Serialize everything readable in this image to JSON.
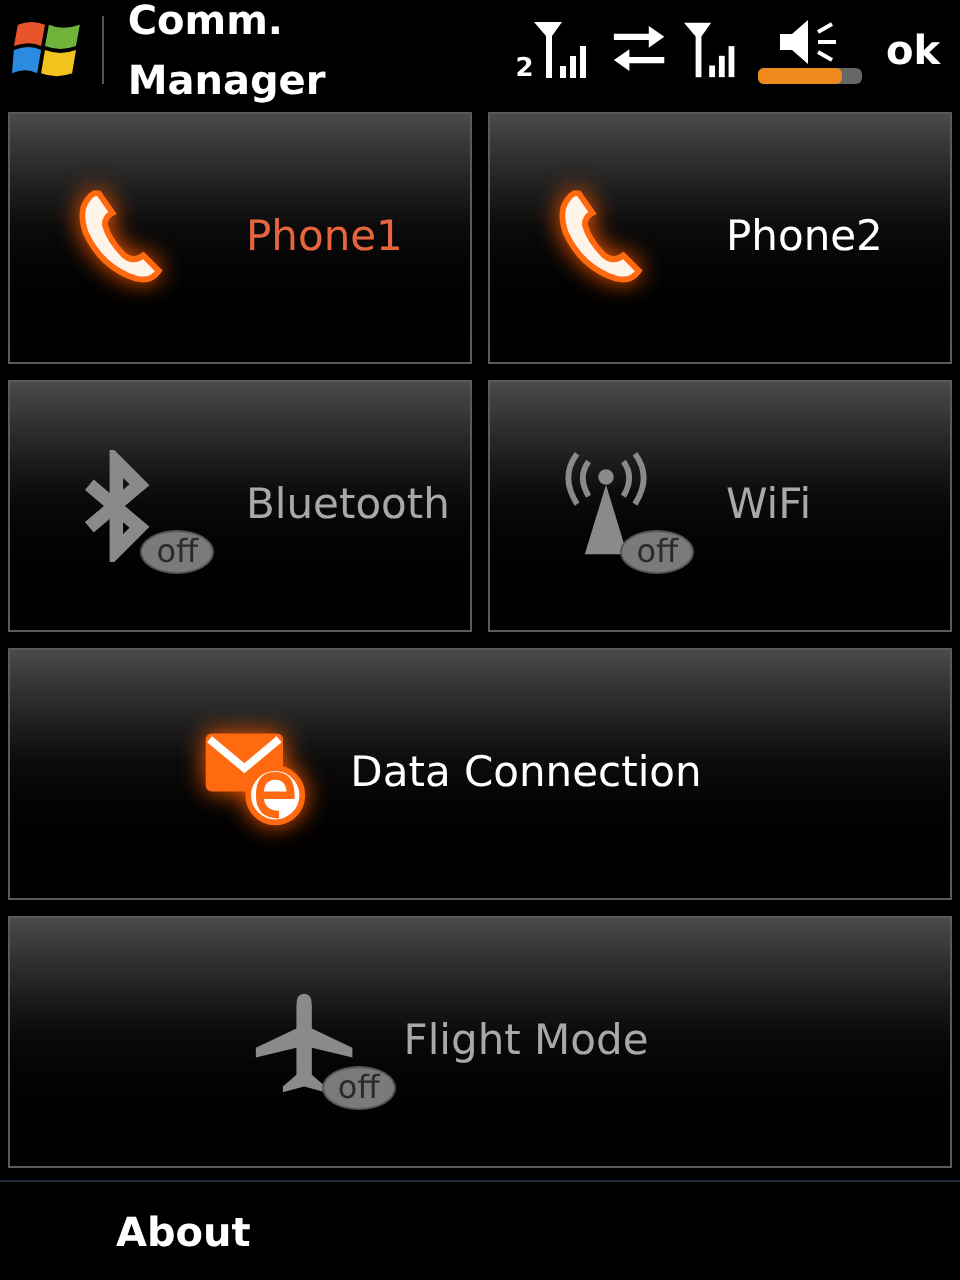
{
  "title_bar": {
    "title": "Comm. Manager",
    "signal_label": "2",
    "ok": "ok"
  },
  "tiles": [
    {
      "kind": "phone",
      "label": "Phone1",
      "on": true,
      "selected": true
    },
    {
      "kind": "phone",
      "label": "Phone2",
      "on": true,
      "selected": false
    },
    {
      "kind": "bluetooth",
      "label": "Bluetooth",
      "on": false,
      "selected": false,
      "badge": "off"
    },
    {
      "kind": "wifi",
      "label": "WiFi",
      "on": false,
      "selected": false,
      "badge": "off"
    },
    {
      "kind": "data",
      "label": "Data Connection",
      "on": true,
      "selected": false
    },
    {
      "kind": "flight",
      "label": "Flight Mode",
      "on": false,
      "selected": false,
      "badge": "off"
    }
  ],
  "softkeys": {
    "left": "About"
  }
}
